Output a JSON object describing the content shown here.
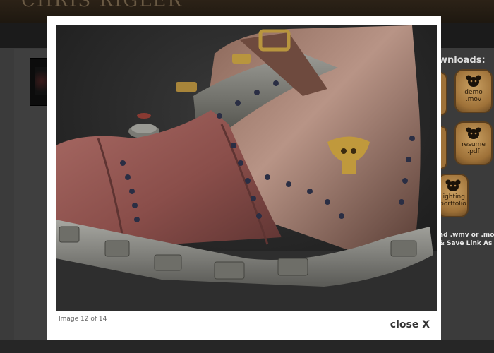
{
  "site": {
    "logo_text": "CHRIS RIGLER"
  },
  "downloads": {
    "title": "wnloads:",
    "items": [
      {
        "label": "demo .mov",
        "icon": "bear-head-icon"
      },
      {
        "label": "resume .pdf",
        "icon": "bear-head-icon"
      },
      {
        "label": "lighting portfolio",
        "icon": "bear-head-icon"
      }
    ],
    "hint_line1": "ad .wmv or .mov",
    "hint_line2": "& Save Link As"
  },
  "lightbox": {
    "caption": "Image 12 of 14",
    "close_label": "close X",
    "image_subject": "steampunk boot render"
  },
  "colors": {
    "lightbox_bg": "#ffffff",
    "page_bg": "#3b3b3b",
    "download_icon": "#b98a4c"
  }
}
